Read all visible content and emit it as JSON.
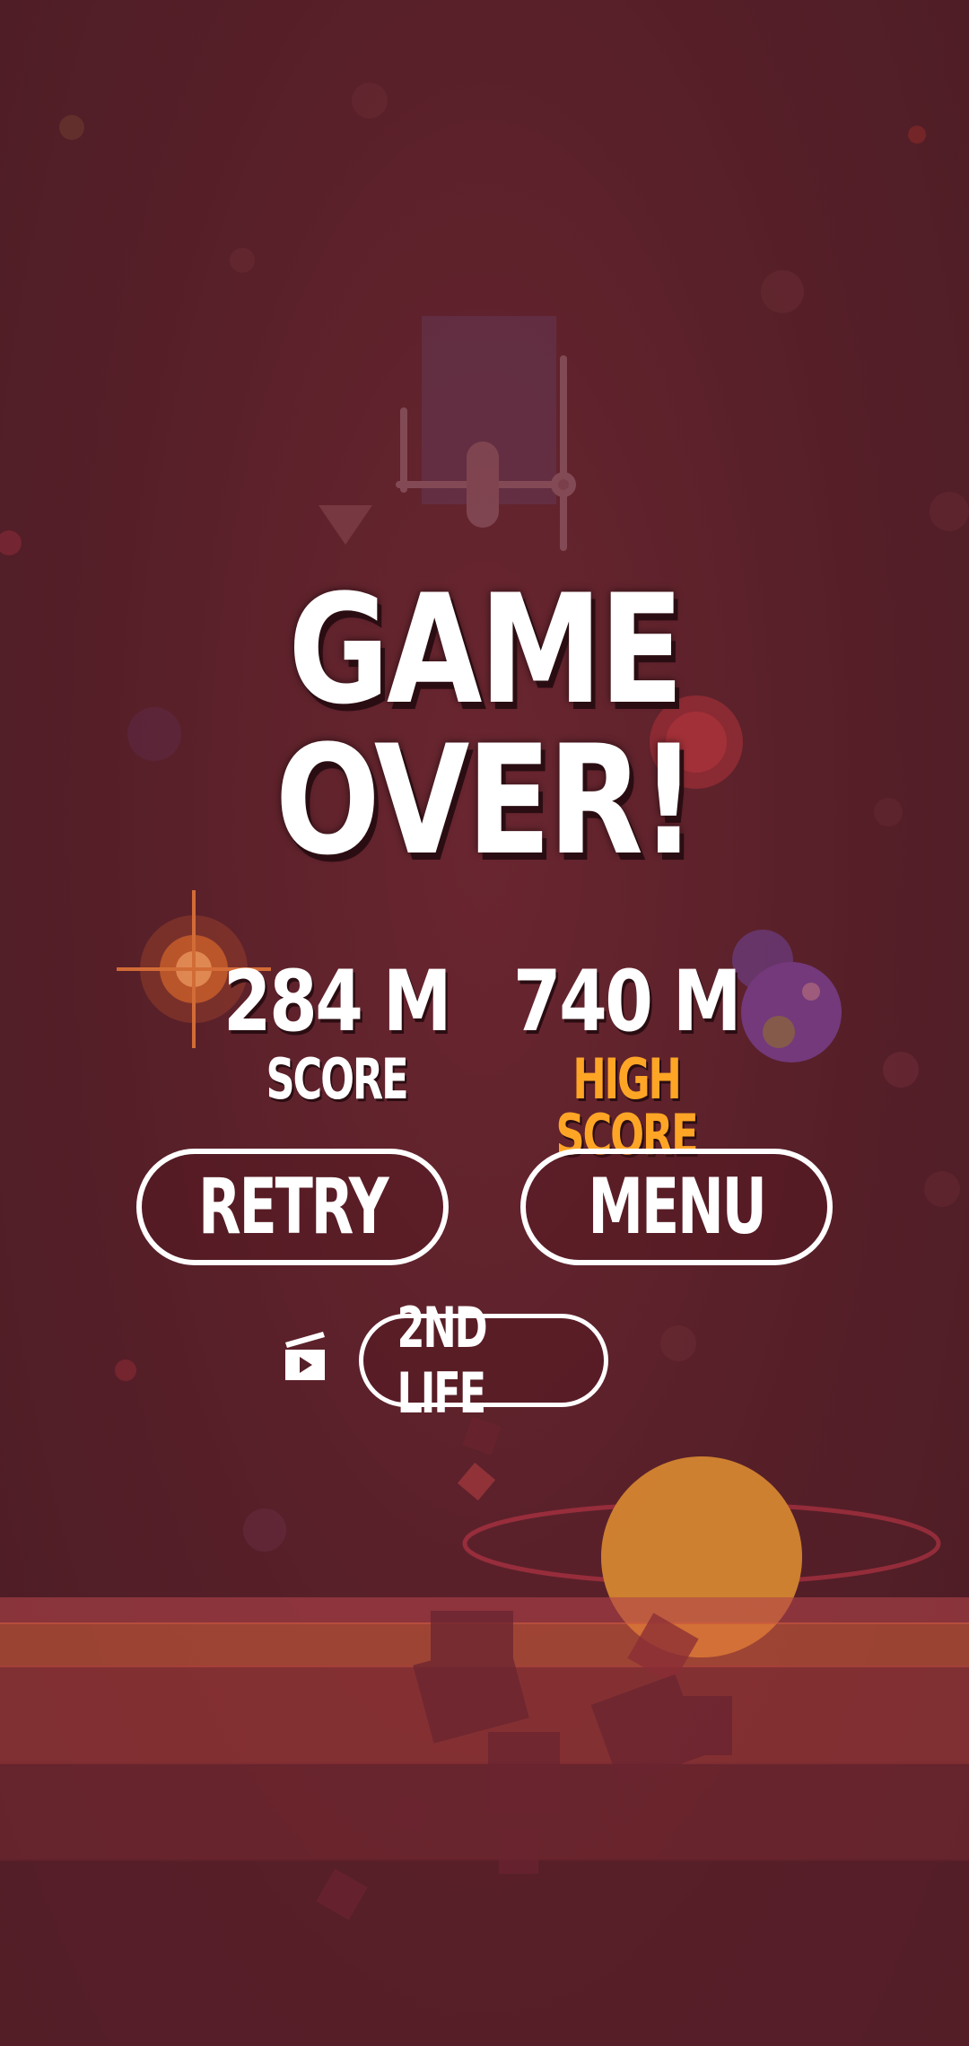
{
  "title": "GAME OVER!",
  "score": {
    "value": "284 M",
    "label": "SCORE"
  },
  "high_score": {
    "value": "740 M",
    "label": "HIGH SCORE"
  },
  "buttons": {
    "retry": "RETRY",
    "menu": "MENU",
    "second_life": "2ND LIFE"
  },
  "icons": {
    "ad": "video-ad-icon"
  },
  "colors": {
    "background": "#54202a",
    "text": "#ffffff",
    "high_score_label": "#ffa526",
    "planet": "#e8922e"
  }
}
